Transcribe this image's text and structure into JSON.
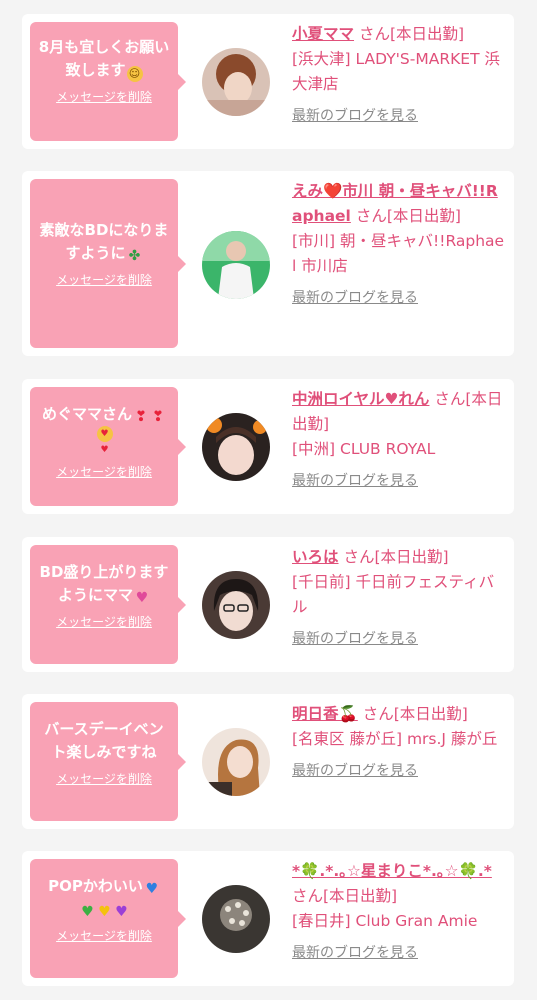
{
  "messages": [
    {
      "text": "8月も宜しくお願い致します",
      "emoji": [
        "hugging-face-emoji"
      ],
      "delete_label": "メッセージを削除",
      "name": "小夏ママ",
      "suffix": "さん[本日出勤]",
      "shop": "[浜大津] LADY'S-MARKET 浜大津店",
      "blog_label": "最新のブログを見る"
    },
    {
      "text": "素敵なBDになりますように",
      "emoji": [
        "four-leaf-clover-emoji"
      ],
      "delete_label": "メッセージを削除",
      "name": "えみ❤️市川 朝・昼キャバ!!Raphael",
      "suffix": "さん[本日出勤]",
      "shop": "[市川] 朝・昼キャバ!!Raphael 市川店",
      "blog_label": "最新のブログを見る"
    },
    {
      "text": "めぐママさん",
      "emoji": [
        "exclamation-heart-emoji",
        "exclamation-heart-emoji",
        "heart-eyes-emoji"
      ],
      "delete_label": "メッセージを削除",
      "name": "中洲ロイヤル♥れん",
      "suffix": "さん[本日出勤]",
      "shop": "[中洲] CLUB ROYAL",
      "blog_label": "最新のブログを見る"
    },
    {
      "text": "BD盛り上がりますようにママ",
      "emoji": [
        "sparkling-heart-emoji"
      ],
      "delete_label": "メッセージを削除",
      "name": "いろは",
      "suffix": "さん[本日出勤]",
      "shop": "[千日前] 千日前フェスティバル",
      "blog_label": "最新のブログを見る"
    },
    {
      "text": "バースデーイベント楽しみですね",
      "emoji": [],
      "delete_label": "メッセージを削除",
      "name": "明日香🍒",
      "suffix": "さん[本日出勤]",
      "shop": "[名東区 藤が丘] mrs.J 藤が丘",
      "blog_label": "最新のブログを見る"
    },
    {
      "text": "POPかわいい",
      "emoji": [
        "blue-heart-emoji",
        "green-heart-emoji",
        "yellow-heart-emoji",
        "purple-heart-emoji"
      ],
      "delete_label": "メッセージを削除",
      "name": "*🍀.*.｡☆星まりこ*.｡☆🍀.*",
      "suffix": "さん[本日出勤]",
      "shop": "[春日井] Club Gran Amie",
      "blog_label": "最新のブログを見る"
    }
  ],
  "colors": {
    "bubble": "#f9a2b5",
    "accent": "#e0507a",
    "blog_link": "#8a8a8a",
    "page_bg": "#f4f4f4"
  }
}
